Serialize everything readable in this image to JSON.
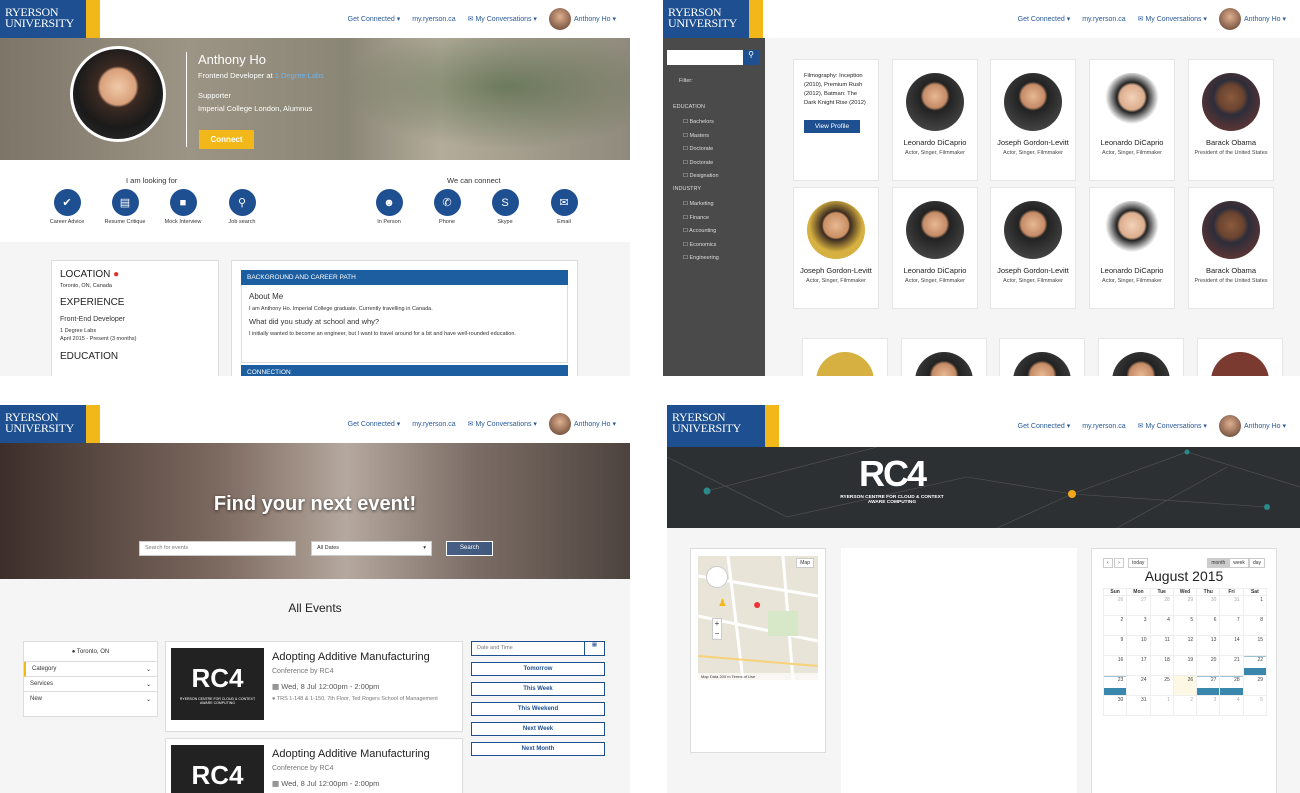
{
  "brand": {
    "logo_line1": "RYERSON",
    "logo_line2": "UNIVERSITY"
  },
  "nav": {
    "get_connected": "Get Connected ▾",
    "my_ryerson": "my.ryerson.ca",
    "my_conversations": "✉ My Conversations ▾",
    "user": "Anthony Ho ▾"
  },
  "profile": {
    "name": "Anthony Ho",
    "role_prefix": "Frontend Developer at ",
    "company": "1 Degree Labs",
    "status": "Supporter",
    "school": "Imperial College London, Alumnus",
    "connect": "Connect",
    "looking_title": "I am looking for",
    "looking": [
      "Career Advice",
      "Resume Critique",
      "Mock Interview",
      "Job search"
    ],
    "connect_title": "We can connect",
    "connect_ways": [
      "In Person",
      "Phone",
      "Skype",
      "Email"
    ],
    "location_h": "LOCATION",
    "location": "Toronto, ON, Canada",
    "experience_h": "EXPERIENCE",
    "exp_title": "Front-End Developer",
    "exp_company": "1 Degree Labs",
    "exp_dates": "April 2015 - Present (3 months)",
    "education_h": "EDUCATION",
    "bg_h": "BACKGROUND AND CAREER PATH",
    "about_h": "About Me",
    "about": "I am Anthony Ho. Imperial College graduate. Currently travelling in Canada.",
    "study_h": "What did you study at school and why?",
    "study": "I initially wanted to become an engineer, but I want to travel around for a bit and have well-rounded education.",
    "connection_h": "CONNECTION"
  },
  "directory": {
    "search_placeholder": "",
    "filter": "Filter:",
    "education_h": "EDUCATION",
    "education": [
      "Bachelors",
      "Masters",
      "Doctorate",
      "Doctorate",
      "Designation"
    ],
    "industry_h": "INDUSTRY",
    "industry": [
      "Marketing",
      "Finance",
      "Accounting",
      "Economics",
      "Engineering"
    ],
    "hover_text": "Filmography: Inception (2010), Premium Rush (2012), Batman: The Dark Knight Rise (2012)",
    "view_profile": "View Profile",
    "row1": [
      {
        "name": "Leonardo DiCaprio",
        "title": "Actor, Singer, Filmmaker"
      },
      {
        "name": "Joseph Gordon-Levitt",
        "title": "Actor, Singer, Filmmaker"
      },
      {
        "name": "Leonardo DiCaprio",
        "title": "Actor, Singer, Filmmaker"
      },
      {
        "name": "Barack Obama",
        "title": "President of the United States"
      }
    ],
    "row2": [
      {
        "name": "Joseph Gordon-Levitt",
        "title": "Actor, Singer, Filmmaker"
      },
      {
        "name": "Leonardo DiCaprio",
        "title": "Actor, Singer, Filmmaker"
      },
      {
        "name": "Joseph Gordon-Levitt",
        "title": "Actor, Singer, Filmmaker"
      },
      {
        "name": "Leonardo DiCaprio",
        "title": "Actor, Singer, Filmmaker"
      },
      {
        "name": "Barack Obama",
        "title": "President of the United States"
      }
    ]
  },
  "events": {
    "hero_title": "Find your next event!",
    "search_placeholder": "Search for events",
    "date_select": "All Dates",
    "search_button": "Search",
    "all_events": "All Events",
    "location": "Toronto, ON",
    "filters": [
      "Category",
      "Services",
      "New"
    ],
    "list": [
      {
        "title": "Adopting Additive Manufacturing",
        "by": "Conference by RC4",
        "when": "Wed, 8 Jul 12:00pm - 2:00pm",
        "where": "TRS 1-148 & 1-150, 7th Floor, Ted Rogers School of Management"
      },
      {
        "title": "Adopting Additive Manufacturing",
        "by": "Conference by RC4",
        "when": "Wed, 8 Jul 12:00pm - 2:00pm",
        "where": ""
      }
    ],
    "thumb_logo": "RC4",
    "thumb_sub": "RYERSON CENTRE FOR CLOUD & CONTEXT AWARE COMPUTING",
    "date_placeholder": "Date and Time",
    "quick": [
      "Tomorrow",
      "This Week",
      "This Weekend",
      "Next Week",
      "Next Month"
    ]
  },
  "rc4": {
    "logo": "RC4",
    "subtitle": "RYERSON CENTRE FOR CLOUD & CONTEXT AWARE COMPUTING",
    "map_type": "Map",
    "map_footer": "Map Data   200 m   Terms of Use",
    "cal_today": "today",
    "cal_views": [
      "month",
      "week",
      "day"
    ],
    "cal_title": "August 2015",
    "cal_days": [
      "Sun",
      "Mon",
      "Tue",
      "Wed",
      "Thu",
      "Fri",
      "Sat"
    ],
    "cal_weeks": [
      [
        "26",
        "27",
        "28",
        "29",
        "30",
        "31",
        "1"
      ],
      [
        "2",
        "3",
        "4",
        "5",
        "6",
        "7",
        "8"
      ],
      [
        "9",
        "10",
        "11",
        "12",
        "13",
        "14",
        "15"
      ],
      [
        "16",
        "17",
        "18",
        "19",
        "20",
        "21",
        "22"
      ],
      [
        "23",
        "24",
        "25",
        "26",
        "27",
        "28",
        "29"
      ],
      [
        "30",
        "31",
        "1",
        "2",
        "3",
        "4",
        "5"
      ]
    ]
  }
}
